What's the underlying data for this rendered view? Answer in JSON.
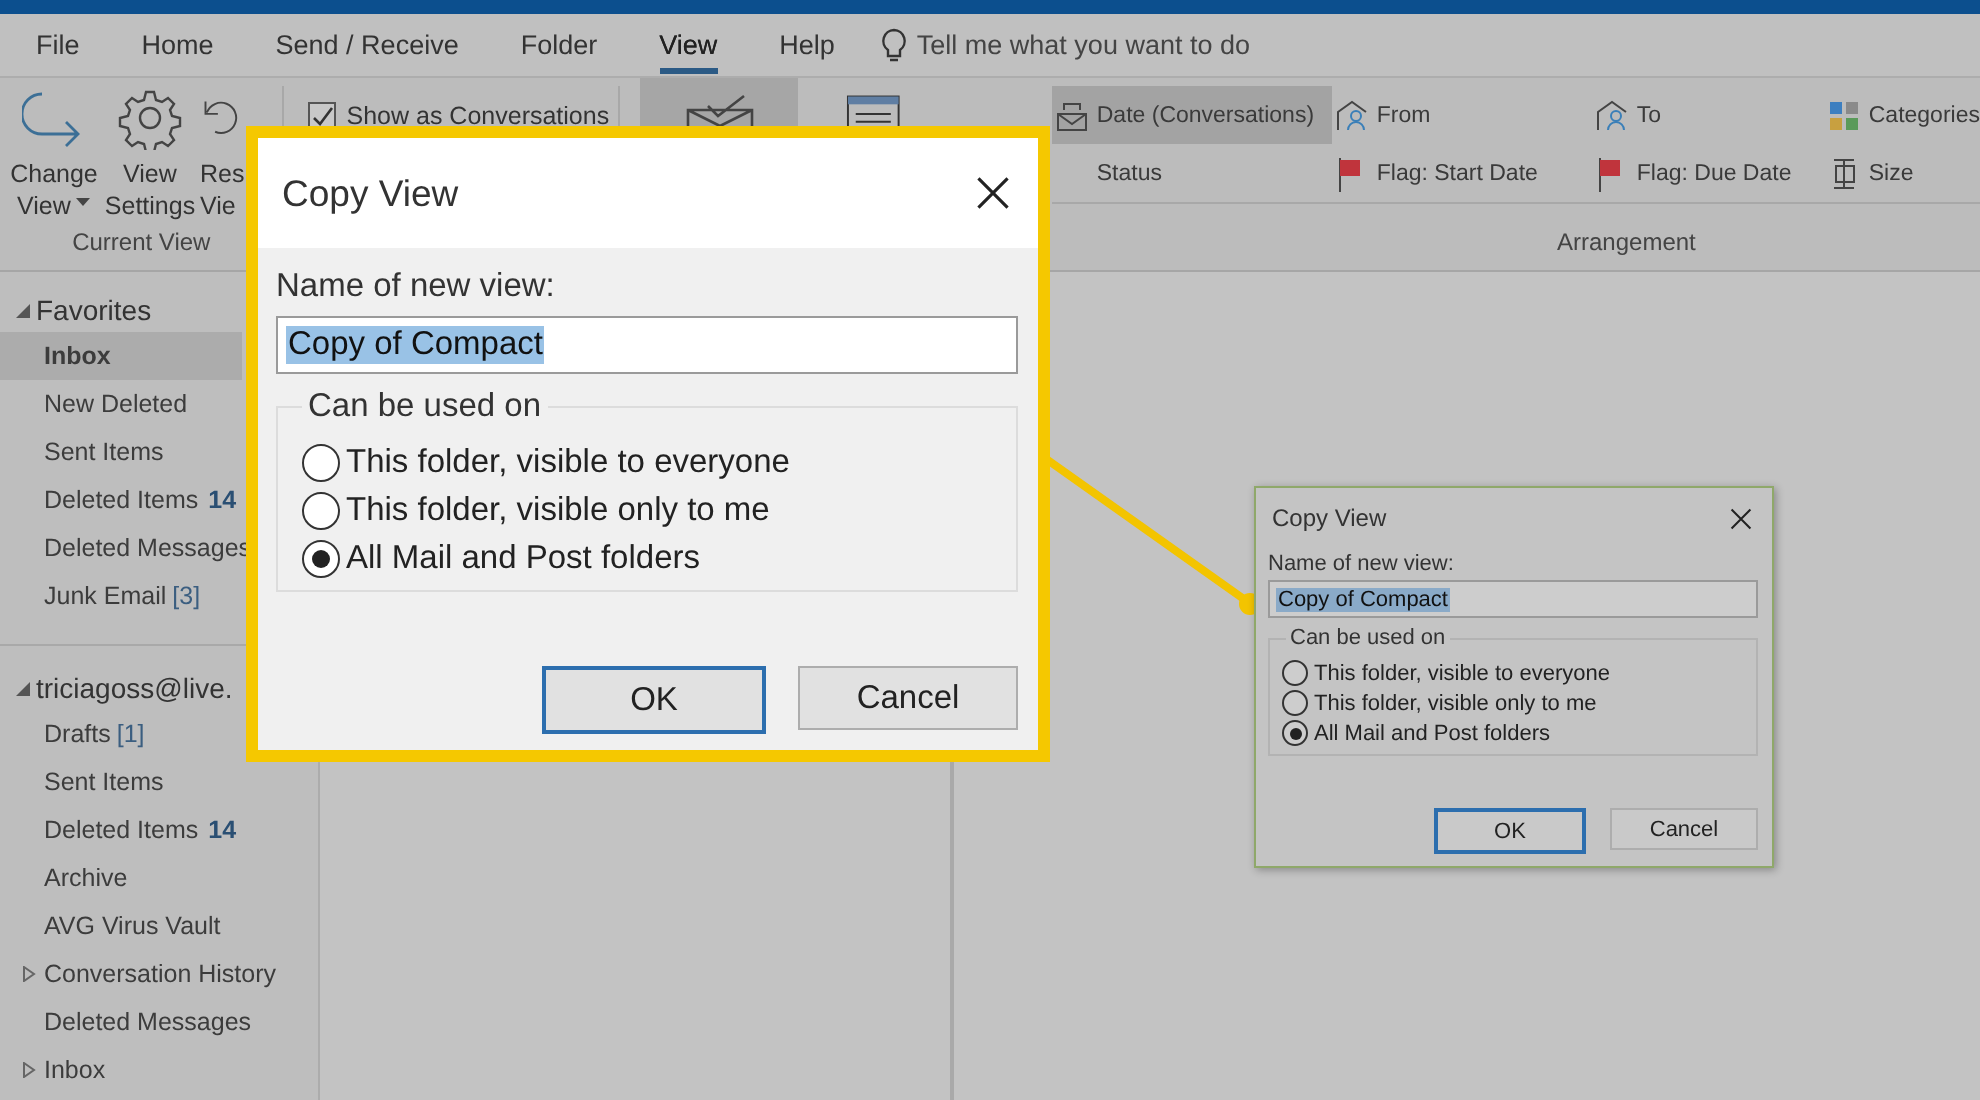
{
  "menu_tabs": [
    {
      "label": "File",
      "selected": false
    },
    {
      "label": "Home",
      "selected": false
    },
    {
      "label": "Send / Receive",
      "selected": false
    },
    {
      "label": "Folder",
      "selected": false
    },
    {
      "label": "View",
      "selected": true
    },
    {
      "label": "Help",
      "selected": false
    }
  ],
  "tell_me": "Tell me what you want to do",
  "ribbon": {
    "current_view": {
      "label": "Current View",
      "buttons": [
        {
          "kind": "change",
          "lines": [
            "Change",
            "View"
          ],
          "dropdown": true
        },
        {
          "kind": "settings",
          "lines": [
            "View",
            "Settings"
          ],
          "dropdown": false
        },
        {
          "kind": "reset",
          "lines": [
            "Res",
            "Vie"
          ],
          "dropdown": false
        }
      ]
    },
    "conversations": {
      "label": "Show as Conversations",
      "checked": true
    },
    "arrangement": {
      "label": "Arrangement",
      "items": [
        {
          "kind": "date",
          "label": "Date (Conversations)",
          "selected": true
        },
        {
          "kind": "person",
          "label": "From",
          "selected": false
        },
        {
          "kind": "person",
          "label": "To",
          "selected": false
        },
        {
          "kind": "categories",
          "label": "Categories",
          "selected": false
        },
        {
          "kind": "plain",
          "label": "Status",
          "selected": false
        },
        {
          "kind": "flag",
          "label": "Flag: Start Date",
          "selected": false
        },
        {
          "kind": "flag",
          "label": "Flag: Due Date",
          "selected": false
        },
        {
          "kind": "size",
          "label": "Size",
          "selected": false
        }
      ]
    }
  },
  "sidebar": {
    "sections": [
      {
        "title": "Favorites",
        "expanded": true,
        "items": [
          {
            "label": "Inbox",
            "selected": true
          },
          {
            "label": "New Deleted",
            "selected": false
          },
          {
            "label": "Sent Items",
            "selected": false
          },
          {
            "label": "Deleted Items",
            "unread": "14",
            "selected": false
          },
          {
            "label": "Deleted Messages",
            "selected": false
          },
          {
            "label": "Junk Email",
            "count": "[3]",
            "selected": false
          }
        ]
      },
      {
        "title": "triciagoss@live.",
        "expanded": true,
        "items": [
          {
            "label": "Drafts",
            "count": "[1]",
            "selected": false
          },
          {
            "label": "Sent Items",
            "selected": false
          },
          {
            "label": "Deleted Items",
            "unread": "14",
            "selected": false
          },
          {
            "label": "Archive",
            "selected": false
          },
          {
            "label": "AVG Virus Vault",
            "selected": false
          },
          {
            "label": "Conversation History",
            "expanded": false,
            "selected": false
          },
          {
            "label": "Deleted Messages",
            "selected": false
          },
          {
            "label": "Inbox",
            "expanded": false,
            "selected": false
          }
        ]
      }
    ]
  },
  "dialog": {
    "title": "Copy View",
    "name_label": "Name of new view:",
    "name_value": "Copy of Compact",
    "group_label": "Can be used on",
    "options": [
      {
        "label": "This folder, visible to everyone",
        "selected": false
      },
      {
        "label": "This folder, visible only to me",
        "selected": false
      },
      {
        "label": "All Mail and Post folders",
        "selected": true
      }
    ],
    "buttons": [
      {
        "label": "OK",
        "default": true
      },
      {
        "label": "Cancel",
        "default": false
      }
    ]
  },
  "magnified_dialog": {
    "title": "Copy View",
    "name_label": "Name of new view:",
    "name_value": "Copy of Compact",
    "group_label": "Can be used on",
    "options": [
      {
        "label": "This folder, visible to everyone",
        "selected": false
      },
      {
        "label": "This folder, visible only to me",
        "selected": false
      },
      {
        "label": "All Mail and Post folders",
        "selected": true
      }
    ],
    "buttons": [
      {
        "label": "OK",
        "default": true
      },
      {
        "label": "Cancel",
        "default": false
      }
    ]
  }
}
